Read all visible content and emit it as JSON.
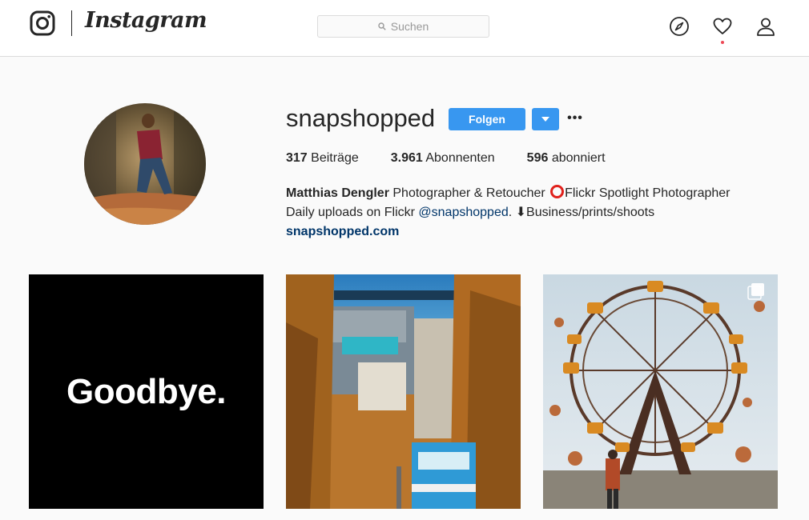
{
  "nav": {
    "brand": "Instagram",
    "search_placeholder": "Suchen",
    "icons": [
      "instagram-logo-icon",
      "search-icon",
      "compass-icon",
      "heart-icon",
      "user-icon"
    ]
  },
  "profile": {
    "username": "snapshopped",
    "follow_label": "Folgen",
    "more_label": "•••",
    "stats": [
      {
        "count": "317",
        "label": "Beiträge"
      },
      {
        "count": "3.961",
        "label": "Abonnenten"
      },
      {
        "count": "596",
        "label": "abonniert"
      }
    ],
    "bio": {
      "full_name": "Matthias Dengler",
      "line1_rest": " Photographer & Retoucher ",
      "line1_after_ring": "Flickr Spotlight Photographer",
      "line2_start": "Daily uploads on Flickr ",
      "mention": "@snapshopped",
      "line2_end": ". ⬇Business/prints/shoots",
      "website": "snapshopped.com"
    }
  },
  "posts": [
    {
      "text": "Goodbye.",
      "icon": null
    },
    {
      "text": "",
      "icon": null
    },
    {
      "text": "",
      "icon": "multiple-photos-icon"
    }
  ],
  "colors": {
    "accent": "#3897f0",
    "link": "#003569",
    "notification": "#ed4956"
  }
}
